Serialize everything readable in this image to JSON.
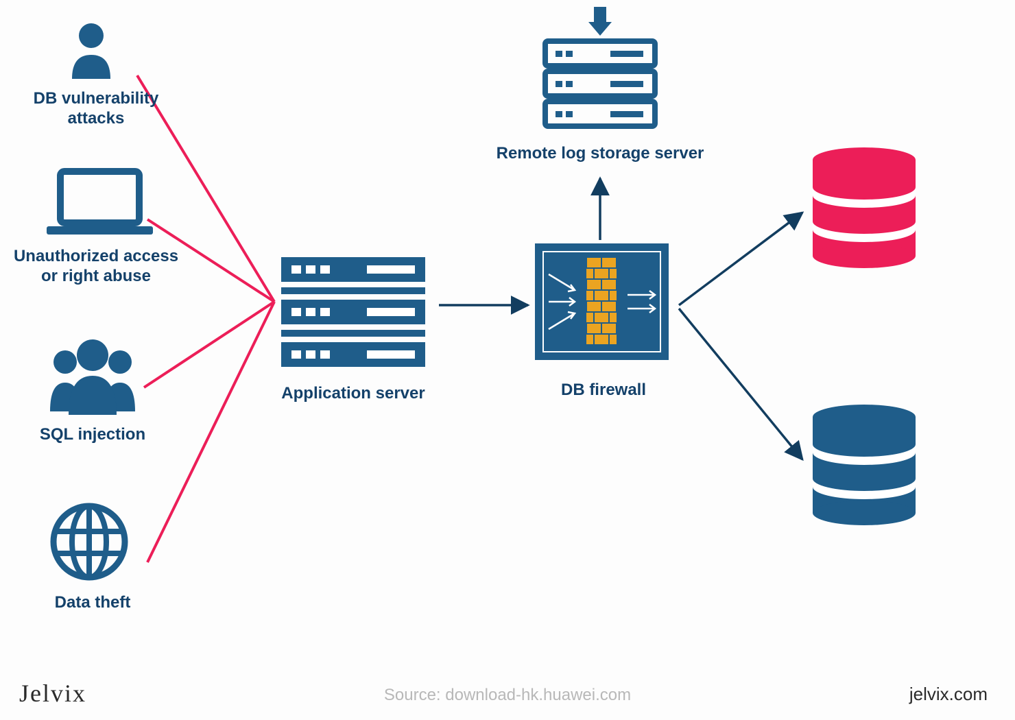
{
  "colors": {
    "blue": "#1f5d8a",
    "darkblue": "#123d5f",
    "pink": "#ec1e58",
    "orange": "#eba421",
    "gray": "#b8b8b8",
    "text": "#14416a"
  },
  "threats": {
    "db_vuln": "DB vulnerability\nattacks",
    "unauth": "Unauthorized access\nor right abuse",
    "sql": "SQL injection",
    "theft": "Data theft"
  },
  "nodes": {
    "app_server": "Application server",
    "log_server": "Remote log storage server",
    "db_firewall": "DB firewall"
  },
  "footer": {
    "brand": "Jelvix",
    "source": "Source: download-hk.huawei.com",
    "site": "jelvix.com"
  }
}
